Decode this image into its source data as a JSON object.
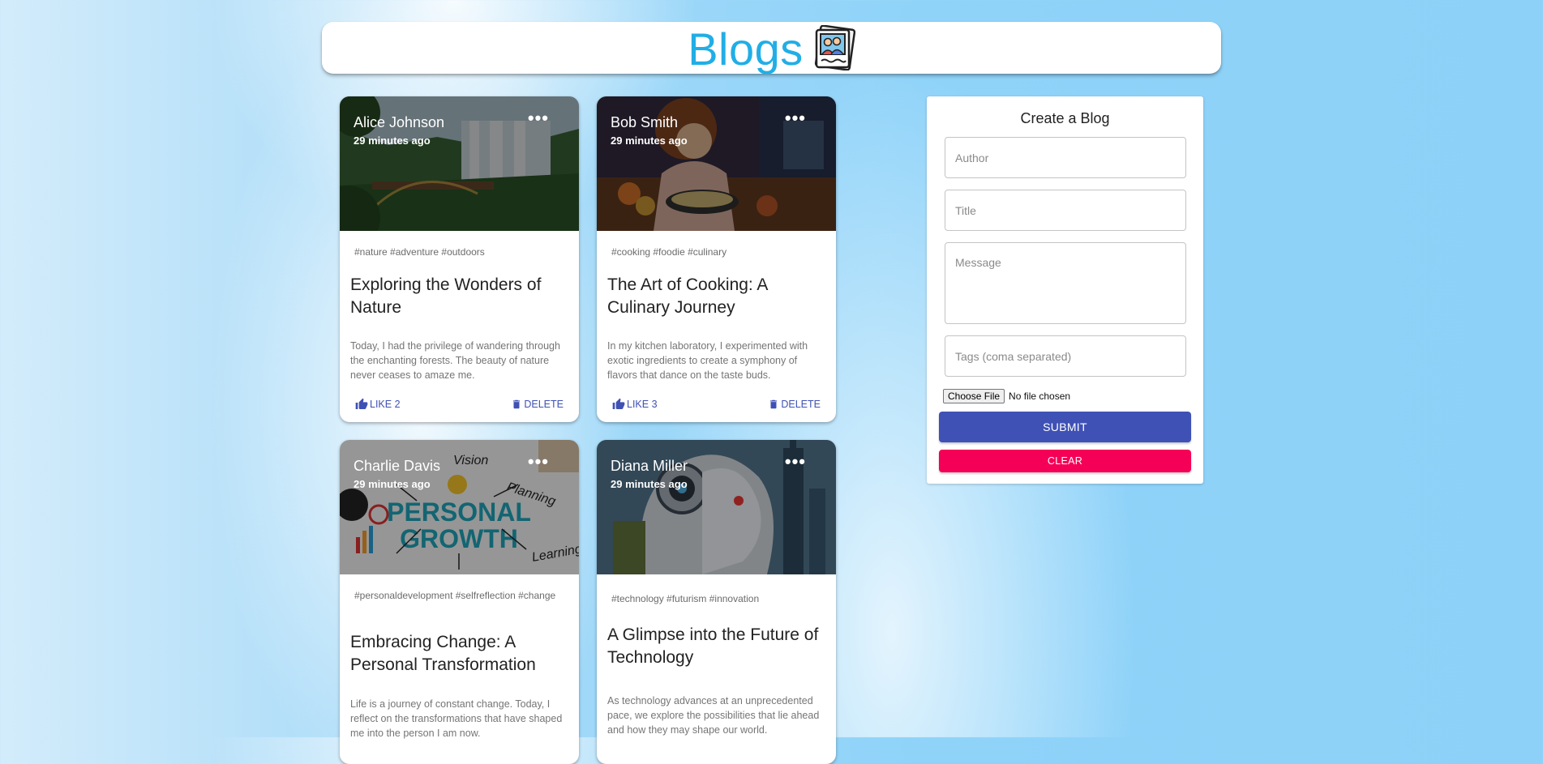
{
  "header": {
    "title": "Blogs",
    "logo_icon": "photo-album-icon"
  },
  "posts": [
    {
      "author": "Alice Johnson",
      "time": "29 minutes ago",
      "tags": "#nature #adventure #outdoors",
      "title": "Exploring the Wonders of Nature",
      "message": "Today, I had the privilege of wandering through the enchanting forests. The beauty of nature never ceases to amaze me.",
      "like_label": "LIKE 2",
      "delete_label": "DELETE",
      "image": "waterfall"
    },
    {
      "author": "Bob Smith",
      "time": "29 minutes ago",
      "tags": "#cooking #foodie #culinary",
      "title": "The Art of Cooking: A Culinary Journey",
      "message": "In my kitchen laboratory, I experimented with exotic ingredients to create a symphony of flavors that dance on the taste buds.",
      "like_label": "LIKE 3",
      "delete_label": "DELETE",
      "image": "girl-cooking"
    },
    {
      "author": "Charlie Davis",
      "time": "29 minutes ago",
      "tags": "#personaldevelopment #selfreflection #change",
      "title": "Embracing Change: A Personal Transformation",
      "message": "Life is a journey of constant change. Today, I reflect on the transformations that have shaped me into the person I am now.",
      "image": "personal-growth",
      "image_text": {
        "line1": "PERSONAL",
        "line2": "GROWTH",
        "vision": "Vision",
        "planning": "Planning",
        "learning": "Learning"
      }
    },
    {
      "author": "Diana Miller",
      "time": "29 minutes ago",
      "tags": "#technology #futurism #innovation",
      "title": "A Glimpse into the Future of Technology",
      "message": "As technology advances at an unprecedented pace, we explore the possibilities that lie ahead and how they may shape our world.",
      "image": "robot-woman"
    }
  ],
  "form": {
    "title": "Create a Blog",
    "author_placeholder": "Author",
    "title_placeholder": "Title",
    "message_placeholder": "Message",
    "tags_placeholder": "Tags (coma separated)",
    "file_button": "Choose File",
    "file_status": "No file chosen",
    "submit_label": "SUBMIT",
    "clear_label": "CLEAR"
  },
  "colors": {
    "title_blue": "#21aee6",
    "primary": "#3f51b5",
    "secondary": "#f50057"
  }
}
